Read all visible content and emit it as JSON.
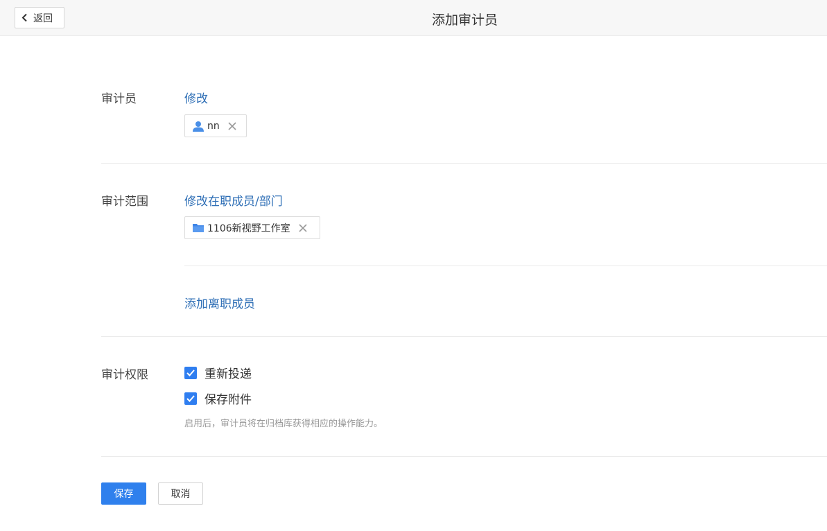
{
  "header": {
    "back_label": "返回",
    "title": "添加审计员"
  },
  "auditor": {
    "label": "审计员",
    "modify_link": "修改",
    "tag": {
      "name": "nn",
      "icon": "user-icon"
    }
  },
  "scope": {
    "label": "审计范围",
    "modify_link": "修改在职成员/部门",
    "tag": {
      "name": "1106新视野工作室",
      "icon": "folder-icon"
    },
    "add_resigned_link": "添加离职成员"
  },
  "permissions": {
    "label": "审计权限",
    "options": [
      {
        "label": "重新投递",
        "checked": true
      },
      {
        "label": "保存附件",
        "checked": true
      }
    ],
    "hint": "启用后，审计员将在归档库获得相应的操作能力。"
  },
  "actions": {
    "save_label": "保存",
    "cancel_label": "取消"
  },
  "colors": {
    "link": "#2f6fb6",
    "primary": "#2f80ed",
    "checkbox": "#2f7ef0",
    "header_bg": "#f7f7f7"
  }
}
